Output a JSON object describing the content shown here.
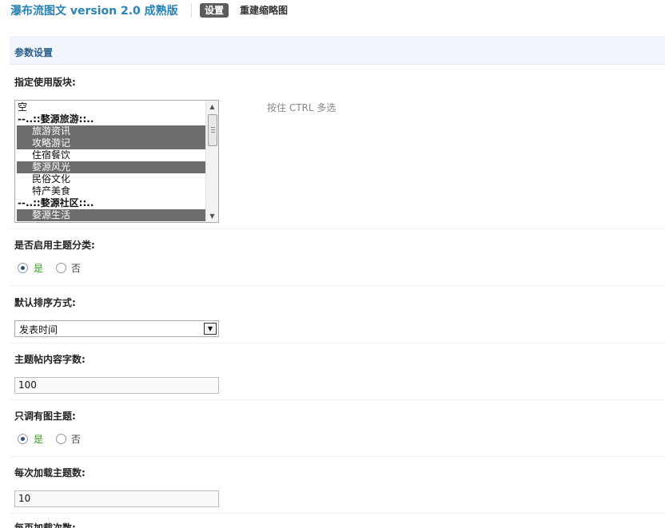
{
  "header": {
    "app_title": "瀑布流图文 version 2.0 成熟版",
    "tabs": [
      {
        "label": "设置",
        "active": true
      },
      {
        "label": "重建缩略图",
        "active": false
      }
    ]
  },
  "section": {
    "title": "参数设置"
  },
  "fields": {
    "forums": {
      "label": "指定使用版块:",
      "hint": "按住 CTRL 多选",
      "options": [
        {
          "label": "空",
          "type": "option",
          "selected": false
        },
        {
          "label": "--..::婺源旅游::..",
          "type": "group",
          "selected": false
        },
        {
          "label": "旅游资讯",
          "type": "child",
          "selected": true
        },
        {
          "label": "攻略游记",
          "type": "child",
          "selected": true
        },
        {
          "label": "住宿餐饮",
          "type": "child",
          "selected": false
        },
        {
          "label": "婺源风光",
          "type": "child",
          "selected": true
        },
        {
          "label": "民俗文化",
          "type": "child",
          "selected": false
        },
        {
          "label": "特产美食",
          "type": "child",
          "selected": false
        },
        {
          "label": "--..::婺源社区::..",
          "type": "group",
          "selected": false
        },
        {
          "label": "婺源生活",
          "type": "child",
          "selected": true
        }
      ]
    },
    "thread_type": {
      "label": "是否启用主题分类:",
      "options": [
        {
          "label": "是",
          "checked": true
        },
        {
          "label": "否",
          "checked": false
        }
      ]
    },
    "sort_order": {
      "label": "默认排序方式:",
      "value": "发表时间"
    },
    "content_length": {
      "label": "主题帖内容字数:",
      "value": "100"
    },
    "image_only": {
      "label": "只调有图主题:",
      "options": [
        {
          "label": "是",
          "checked": true
        },
        {
          "label": "否",
          "checked": false
        }
      ]
    },
    "per_load": {
      "label": "每次加载主题数:",
      "value": "10"
    },
    "per_page_loads": {
      "label": "每页加载次数:"
    }
  },
  "icons": {
    "scroll_up": "triangle-up",
    "scroll_down": "triangle-down",
    "select_arrow": "triangle-down"
  },
  "colors": {
    "title": "#2a82b4",
    "active_tab_bg": "#5b5b5b",
    "section_bg": "#f0f6fc",
    "selected_option_bg": "#6d6d6d",
    "yes_label": "#3a9a28"
  }
}
